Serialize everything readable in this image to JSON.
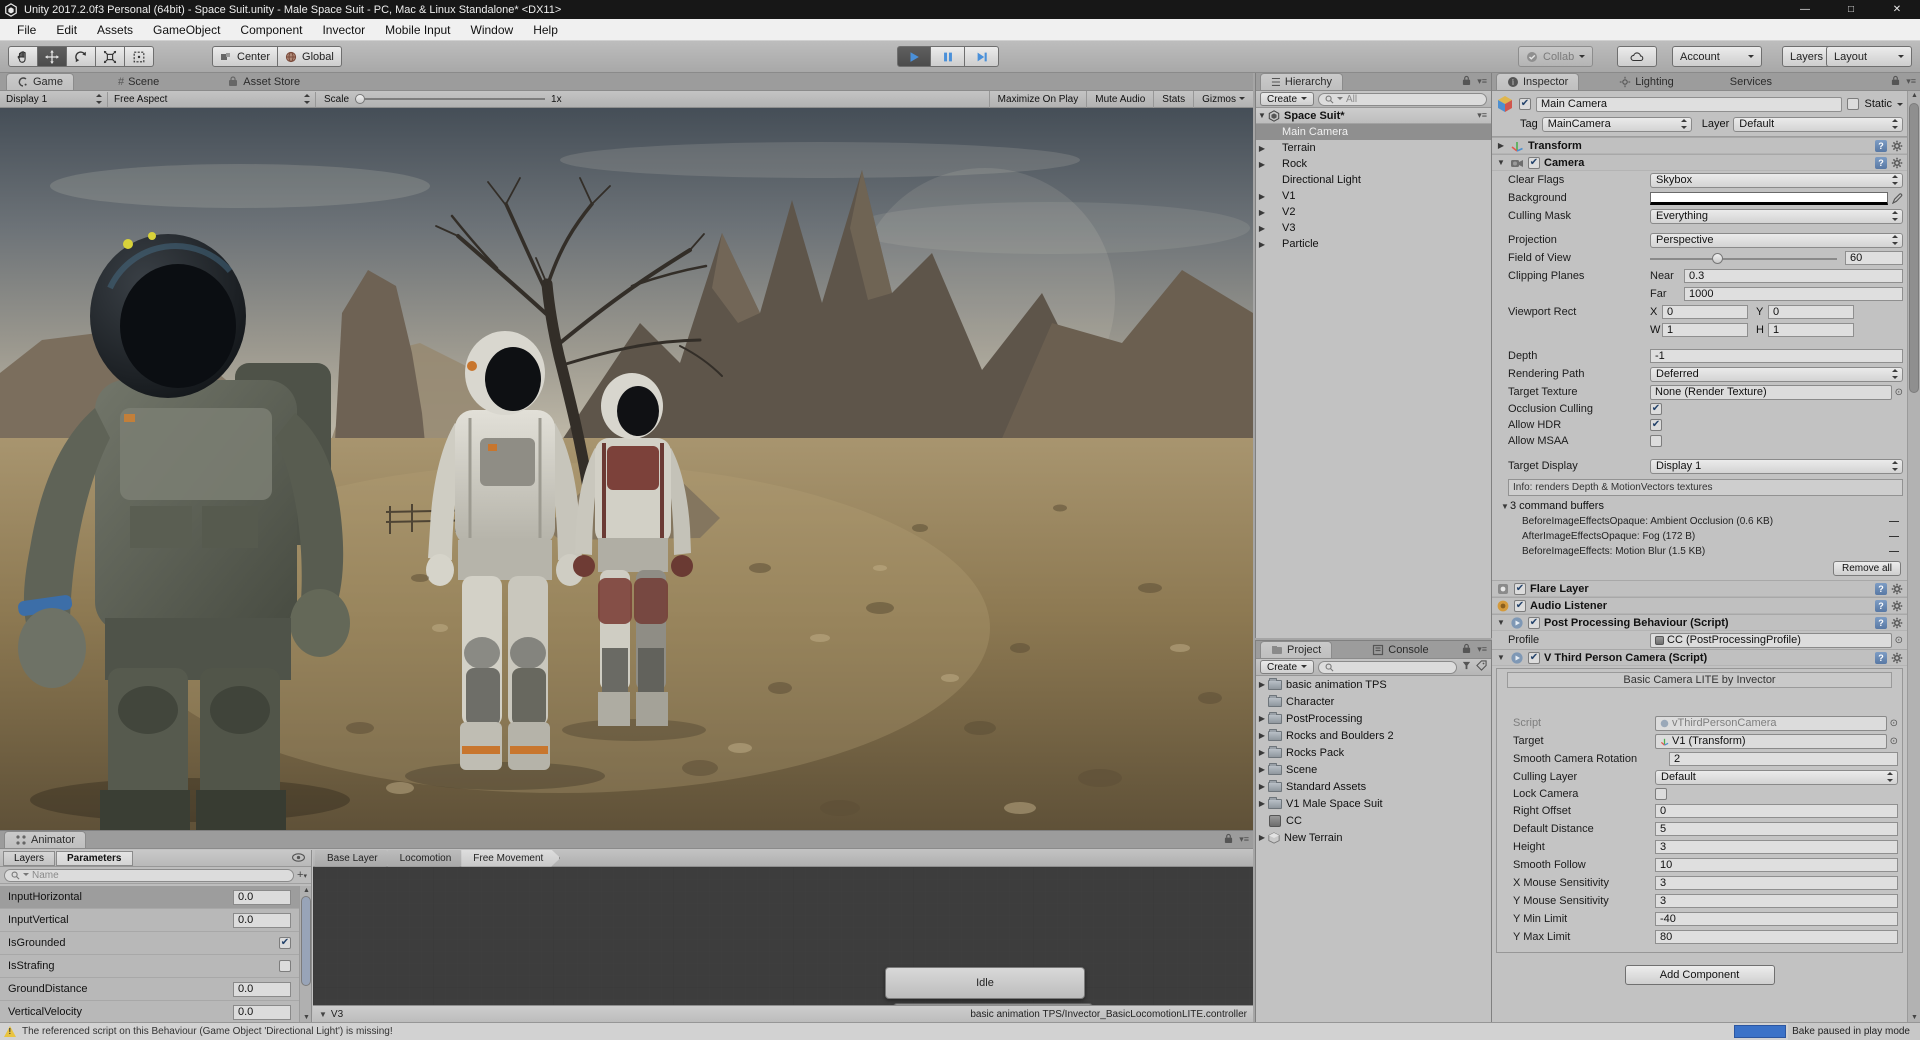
{
  "title_bar": {
    "title": "Unity 2017.2.0f3 Personal (64bit) - Space Suit.unity - Male Space Suit - PC, Mac & Linux Standalone* <DX11>"
  },
  "menu_bar": {
    "items": [
      "File",
      "Edit",
      "Assets",
      "GameObject",
      "Component",
      "Invector",
      "Mobile Input",
      "Window",
      "Help"
    ]
  },
  "toolbar": {
    "center": "Center",
    "global": "Global",
    "collab": "Collab",
    "account": "Account",
    "layers": "Layers",
    "layout": "Layout"
  },
  "game": {
    "tab_game": "Game",
    "tab_scene": "Scene",
    "tab_asset_store": "Asset Store",
    "display": "Display 1",
    "aspect": "Free Aspect",
    "scale_label": "Scale",
    "scale_value": "1x",
    "maximize": "Maximize On Play",
    "mute": "Mute Audio",
    "stats": "Stats",
    "gizmos": "Gizmos"
  },
  "hierarchy": {
    "tab": "Hierarchy",
    "create": "Create",
    "search": "All",
    "scene": "Space Suit*",
    "items": [
      {
        "label": "Main Camera"
      },
      {
        "label": "Terrain"
      },
      {
        "label": "Rock"
      },
      {
        "label": "Directional Light"
      },
      {
        "label": "V1"
      },
      {
        "label": "V2"
      },
      {
        "label": "V3"
      },
      {
        "label": "Particle"
      }
    ]
  },
  "project": {
    "tab_project": "Project",
    "tab_console": "Console",
    "create": "Create",
    "items": [
      {
        "label": "basic animation TPS"
      },
      {
        "label": "Character"
      },
      {
        "label": "PostProcessing"
      },
      {
        "label": "Rocks and Boulders 2"
      },
      {
        "label": "Rocks Pack"
      },
      {
        "label": "Scene"
      },
      {
        "label": "Standard Assets"
      },
      {
        "label": "V1 Male Space Suit"
      },
      {
        "label": "CC"
      },
      {
        "label": "New Terrain"
      }
    ]
  },
  "inspector": {
    "tab_inspector": "Inspector",
    "tab_lighting": "Lighting",
    "tab_services": "Services",
    "header": {
      "name": "Main Camera",
      "static_label": "Static",
      "tag_label": "Tag",
      "tag": "MainCamera",
      "layer_label": "Layer",
      "layer": "Default"
    },
    "transform": {
      "title": "Transform"
    },
    "camera": {
      "title": "Camera",
      "clear_flags_label": "Clear Flags",
      "clear_flags": "Skybox",
      "background_label": "Background",
      "culling_mask_label": "Culling Mask",
      "culling_mask": "Everything",
      "projection_label": "Projection",
      "projection": "Perspective",
      "fov_label": "Field of View",
      "fov": "60",
      "clipping_label": "Clipping Planes",
      "near_label": "Near",
      "near": "0.3",
      "far_label": "Far",
      "far": "1000",
      "viewport_label": "Viewport Rect",
      "x_label": "X",
      "x": "0",
      "y_label": "Y",
      "y": "0",
      "w_label": "W",
      "w": "1",
      "h_label": "H",
      "h": "1",
      "depth_label": "Depth",
      "depth": "-1",
      "rendering_path_label": "Rendering Path",
      "rendering_path": "Deferred",
      "target_texture_label": "Target Texture",
      "target_texture": "None (Render Texture)",
      "occlusion_label": "Occlusion Culling",
      "hdr_label": "Allow HDR",
      "msaa_label": "Allow MSAA",
      "target_display_label": "Target Display",
      "target_display": "Display 1",
      "info": "Info: renders Depth & MotionVectors textures",
      "buffers_title": "3 command buffers",
      "buffers": [
        "BeforeImageEffectsOpaque: Ambient Occlusion (0.6 KB)",
        "AfterImageEffectsOpaque: Fog (172 B)",
        "BeforeImageEffects: Motion Blur (1.5 KB)"
      ],
      "remove_all": "Remove all"
    },
    "flare": {
      "title": "Flare Layer"
    },
    "audio": {
      "title": "Audio Listener"
    },
    "post": {
      "title": "Post Processing Behaviour (Script)",
      "profile_label": "Profile",
      "profile": "CC (PostProcessingProfile)"
    },
    "tpc": {
      "title": "V Third Person Camera (Script)",
      "banner": "Basic Camera LITE by Invector",
      "script_label": "Script",
      "script": "vThirdPersonCamera",
      "target_label": "Target",
      "target": "V1 (Transform)",
      "smooth_rot_label": "Smooth Camera Rotation",
      "smooth_rot": "2",
      "culling_layer_label": "Culling Layer",
      "culling_layer": "Default",
      "lock_label": "Lock Camera",
      "right_offset_label": "Right Offset",
      "right_offset": "0",
      "default_distance_label": "Default Distance",
      "default_distance": "5",
      "height_label": "Height",
      "height": "3",
      "smooth_follow_label": "Smooth Follow",
      "smooth_follow": "10",
      "x_sens_label": "X Mouse Sensitivity",
      "x_sens": "3",
      "y_sens_label": "Y Mouse Sensitivity",
      "y_sens": "3",
      "y_min_label": "Y Min Limit",
      "y_min": "-40",
      "y_max_label": "Y Max Limit",
      "y_max": "80"
    },
    "add_component": "Add Component"
  },
  "animator": {
    "tab": "Animator",
    "layers": "Layers",
    "parameters": "Parameters",
    "search": "Name",
    "params": [
      {
        "name": "InputHorizontal",
        "value": "0.0"
      },
      {
        "name": "InputVertical",
        "value": "0.0"
      },
      {
        "name": "IsGrounded",
        "checked": "true"
      },
      {
        "name": "IsStrafing",
        "checked": "false"
      },
      {
        "name": "GroundDistance",
        "value": "0.0"
      },
      {
        "name": "VerticalVelocity",
        "value": "0.0"
      }
    ],
    "breadcrumb": [
      "Base Layer",
      "Locomotion",
      "Free Movement"
    ],
    "node_idle": "Idle",
    "footer_left": "V3",
    "footer_right": "basic animation TPS/Invector_BasicLocomotionLITE.controller"
  },
  "status_bar": {
    "warning": "The referenced script on this Behaviour (Game Object 'Directional Light') is missing!",
    "bake": "Bake paused in play mode"
  }
}
